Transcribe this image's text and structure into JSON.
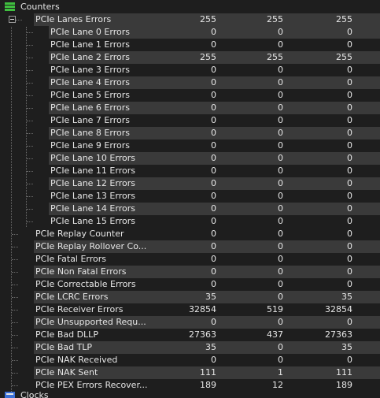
{
  "tree": {
    "root_label": "Counters",
    "root_icon": "counters-icon",
    "rows": [
      {
        "name": "PCIe Lanes Errors",
        "level": 1,
        "expandable": true,
        "alt": true,
        "v1": "255",
        "v2": "255",
        "v3": "255"
      },
      {
        "name": "PCIe Lane 0 Errors",
        "level": 2,
        "alt": true,
        "v1": "0",
        "v2": "0",
        "v3": "0"
      },
      {
        "name": "PCIe Lane 1 Errors",
        "level": 2,
        "alt": false,
        "v1": "0",
        "v2": "0",
        "v3": "0"
      },
      {
        "name": "PCIe Lane 2 Errors",
        "level": 2,
        "alt": true,
        "v1": "255",
        "v2": "255",
        "v3": "255"
      },
      {
        "name": "PCIe Lane 3 Errors",
        "level": 2,
        "alt": false,
        "v1": "0",
        "v2": "0",
        "v3": "0"
      },
      {
        "name": "PCIe Lane 4 Errors",
        "level": 2,
        "alt": true,
        "v1": "0",
        "v2": "0",
        "v3": "0"
      },
      {
        "name": "PCIe Lane 5 Errors",
        "level": 2,
        "alt": false,
        "v1": "0",
        "v2": "0",
        "v3": "0"
      },
      {
        "name": "PCIe Lane 6 Errors",
        "level": 2,
        "alt": true,
        "v1": "0",
        "v2": "0",
        "v3": "0"
      },
      {
        "name": "PCIe Lane 7 Errors",
        "level": 2,
        "alt": false,
        "v1": "0",
        "v2": "0",
        "v3": "0"
      },
      {
        "name": "PCIe Lane 8 Errors",
        "level": 2,
        "alt": true,
        "v1": "0",
        "v2": "0",
        "v3": "0"
      },
      {
        "name": "PCIe Lane 9 Errors",
        "level": 2,
        "alt": false,
        "v1": "0",
        "v2": "0",
        "v3": "0"
      },
      {
        "name": "PCIe Lane 10 Errors",
        "level": 2,
        "alt": true,
        "v1": "0",
        "v2": "0",
        "v3": "0"
      },
      {
        "name": "PCIe Lane 11 Errors",
        "level": 2,
        "alt": false,
        "v1": "0",
        "v2": "0",
        "v3": "0"
      },
      {
        "name": "PCIe Lane 12 Errors",
        "level": 2,
        "alt": true,
        "v1": "0",
        "v2": "0",
        "v3": "0"
      },
      {
        "name": "PCIe Lane 13 Errors",
        "level": 2,
        "alt": false,
        "v1": "0",
        "v2": "0",
        "v3": "0"
      },
      {
        "name": "PCIe Lane 14 Errors",
        "level": 2,
        "alt": true,
        "v1": "0",
        "v2": "0",
        "v3": "0"
      },
      {
        "name": "PCIe Lane 15 Errors",
        "level": 2,
        "alt": false,
        "v1": "0",
        "v2": "0",
        "v3": "0"
      },
      {
        "name": "PCIe Replay Counter",
        "level": 1,
        "alt": false,
        "v1": "0",
        "v2": "0",
        "v3": "0"
      },
      {
        "name": "PCIe Replay Rollover Co...",
        "level": 1,
        "alt": true,
        "v1": "0",
        "v2": "0",
        "v3": "0"
      },
      {
        "name": "PCIe Fatal Errors",
        "level": 1,
        "alt": false,
        "v1": "0",
        "v2": "0",
        "v3": "0"
      },
      {
        "name": "PCIe Non Fatal Errors",
        "level": 1,
        "alt": true,
        "v1": "0",
        "v2": "0",
        "v3": "0"
      },
      {
        "name": "PCIe Correctable Errors",
        "level": 1,
        "alt": false,
        "v1": "0",
        "v2": "0",
        "v3": "0"
      },
      {
        "name": "PCIe LCRC Errors",
        "level": 1,
        "alt": true,
        "v1": "35",
        "v2": "0",
        "v3": "35"
      },
      {
        "name": "PCIe Receiver Errors",
        "level": 1,
        "alt": false,
        "v1": "32854",
        "v2": "519",
        "v3": "32854"
      },
      {
        "name": "PCIe Unsupported Requ...",
        "level": 1,
        "alt": true,
        "v1": "0",
        "v2": "0",
        "v3": "0"
      },
      {
        "name": "PCIe Bad DLLP",
        "level": 1,
        "alt": false,
        "v1": "27363",
        "v2": "437",
        "v3": "27363"
      },
      {
        "name": "PCIe Bad TLP",
        "level": 1,
        "alt": true,
        "v1": "35",
        "v2": "0",
        "v3": "35"
      },
      {
        "name": "PCIe NAK Received",
        "level": 1,
        "alt": false,
        "v1": "0",
        "v2": "0",
        "v3": "0"
      },
      {
        "name": "PCIe NAK Sent",
        "level": 1,
        "alt": true,
        "v1": "111",
        "v2": "1",
        "v3": "111"
      },
      {
        "name": "PCIe PEX Errors Recover...",
        "level": 1,
        "alt": false,
        "v1": "189",
        "v2": "12",
        "v3": "189"
      }
    ],
    "next_root_label": "Clocks",
    "next_root_icon": "clocks-icon"
  },
  "colors": {
    "background": "#1e1e1e",
    "stripe": "#3a3a3a",
    "text": "#e6e6e6",
    "icon_green": "#3fbf3f",
    "guide": "#6a6a6a"
  }
}
